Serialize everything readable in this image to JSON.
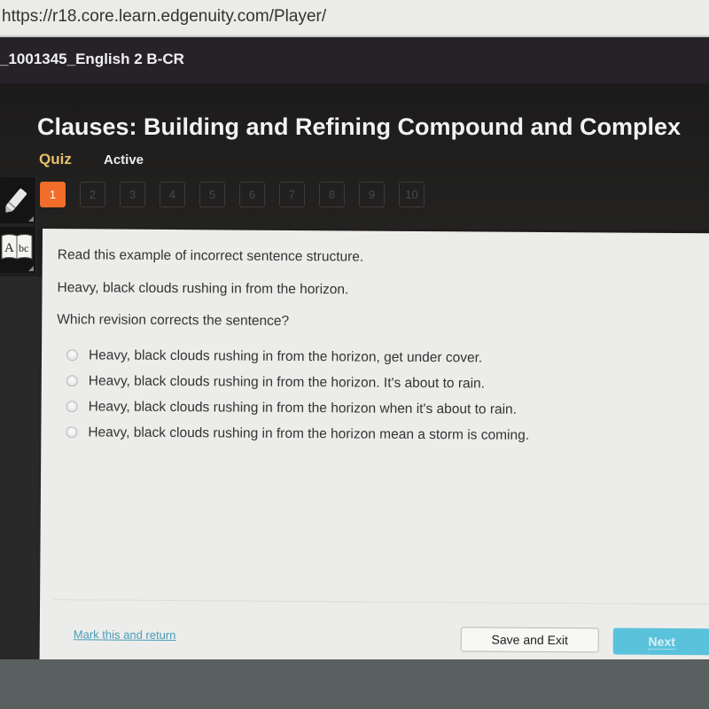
{
  "browser": {
    "url": "https://r18.core.learn.edgenuity.com/Player/"
  },
  "course": {
    "title": "_1001345_English 2 B-CR"
  },
  "header": {
    "lesson_title": "Clauses: Building and Refining Compound and Complex",
    "activity_type": "Quiz",
    "status": "Active"
  },
  "question_nav": {
    "current": 1,
    "items": [
      "1",
      "2",
      "3",
      "4",
      "5",
      "6",
      "7",
      "8",
      "9",
      "10"
    ]
  },
  "tools": [
    {
      "name": "pencil-icon"
    },
    {
      "name": "dictionary-icon",
      "label": "Abc"
    }
  ],
  "question": {
    "instruction": "Read this example of incorrect sentence structure.",
    "example": "Heavy, black clouds rushing in from the horizon.",
    "prompt": "Which revision corrects the sentence?",
    "options": [
      "Heavy, black clouds rushing in from the horizon, get under cover.",
      "Heavy, black clouds rushing in from the horizon. It's about to rain.",
      "Heavy, black clouds rushing in from the horizon when it's about to rain.",
      "Heavy, black clouds rushing in from the horizon mean a storm is coming."
    ],
    "selected": null
  },
  "footer": {
    "mark_link": "Mark this and return",
    "save_button": "Save and Exit",
    "next_button": "Next"
  },
  "colors": {
    "accent_orange": "#f06d2a",
    "quiz_label": "#e8c06a",
    "next_button": "#5bc2dc",
    "link": "#4a9cb8"
  }
}
